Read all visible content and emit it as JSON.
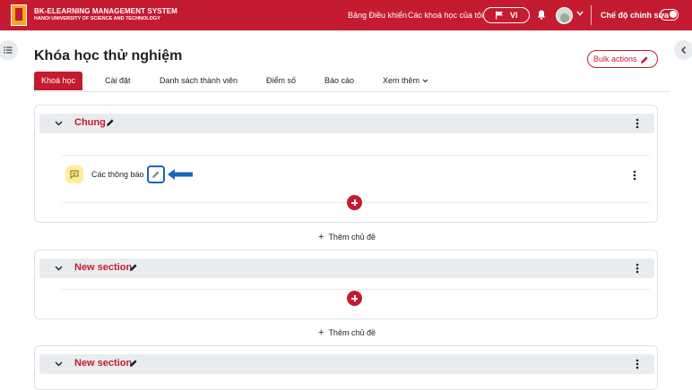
{
  "header": {
    "brand_title": "BK-ELEARNING MANAGEMENT SYSTEM",
    "brand_subtitle": "HANOI UNIVERSITY OF SCIENCE AND TECHNOLOGY",
    "nav": {
      "dashboard": "Bảng Điều khiển",
      "my_courses": "Các khoá học của tôi"
    },
    "language": "VI",
    "edit_mode_label": "Chế độ chỉnh sửa",
    "edit_mode_on": true
  },
  "course": {
    "title": "Khóa học thử nghiệm",
    "bulk_actions_label": "Bulk actions",
    "tabs": [
      "Khoá học",
      "Cài đặt",
      "Danh sách thành viên",
      "Điểm số",
      "Báo cáo",
      "Xem thêm"
    ],
    "active_tab": "Khoá học"
  },
  "sections": [
    {
      "title": "Chung",
      "activities": [
        {
          "name": "Các thông báo",
          "icon": "forum-icon"
        }
      ],
      "add_topic_label": "Thêm chủ đề"
    },
    {
      "title": "New section",
      "activities": [],
      "add_topic_label": "Thêm chủ đề"
    },
    {
      "title": "New section",
      "activities": []
    }
  ],
  "colors": {
    "brand": "#c41b31",
    "highlight": "#1565c0",
    "section_header_bg": "#e9ecef",
    "forum_icon_bg": "#fbeea0"
  }
}
